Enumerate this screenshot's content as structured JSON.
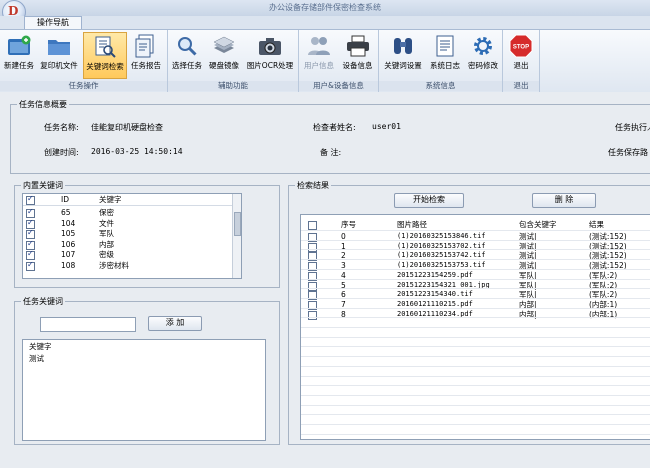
{
  "app": {
    "title": "办公设备存储部件保密检查系统",
    "logo_glyph": "D",
    "nav_tab": "操作导航"
  },
  "ribbon": {
    "groups": [
      {
        "label": "任务操作"
      },
      {
        "label": "辅助功能"
      },
      {
        "label": "用户&设备信息"
      },
      {
        "label": "系统信息"
      },
      {
        "label": "退出"
      }
    ],
    "buttons": {
      "new_task": "新建任务",
      "copier_files": "复印机文件",
      "keyword_search": "关键词检索",
      "task_report": "任务报告",
      "select_task": "选择任务",
      "disk_image": "硬盘镜像",
      "image_ocr": "图片OCR处理",
      "user_info": "用户信息",
      "device_info": "设备信息",
      "keyword_settings": "关键词设置",
      "system_log": "系统日志",
      "change_password": "密码修改",
      "exit": "退出",
      "stop_glyph": "STOP"
    }
  },
  "overview": {
    "legend": "任务信息概要",
    "task_name_label": "任务名称:",
    "task_name": "佳能复印机硬盘检查",
    "inspector_label": "检查者姓名:",
    "inspector": "user01",
    "executor_label": "任务执行人",
    "created_label": "创建时间:",
    "created": "2016-03-25 14:50:14",
    "note_label": "备      注:",
    "save_path_label": "任务保存路"
  },
  "builtin_keywords": {
    "legend": "内置关键词",
    "columns": [
      "ID",
      "关键字"
    ],
    "rows": [
      {
        "id": "65",
        "keyword": "保密"
      },
      {
        "id": "104",
        "keyword": "文件"
      },
      {
        "id": "105",
        "keyword": "军队"
      },
      {
        "id": "106",
        "keyword": "内部"
      },
      {
        "id": "107",
        "keyword": "密级"
      },
      {
        "id": "108",
        "keyword": "涉密材料"
      }
    ]
  },
  "task_keywords": {
    "legend": "任务关键词",
    "add_button": "添  加",
    "input_value": "",
    "column": "关键字",
    "rows": [
      "测试"
    ]
  },
  "results": {
    "legend": "检索结果",
    "start_button": "开始检索",
    "delete_button": "删  除",
    "columns": [
      "序号",
      "图片路径",
      "包含关键字",
      "结果"
    ],
    "rows": [
      {
        "no": "0",
        "path": "(1)20160325153846.tif",
        "kw": "测试|",
        "result": "(测试:152)"
      },
      {
        "no": "1",
        "path": "(1)20160325153702.tif",
        "kw": "测试|",
        "result": "(测试:152)"
      },
      {
        "no": "2",
        "path": "(1)20160325153742.tif",
        "kw": "测试|",
        "result": "(测试:152)"
      },
      {
        "no": "3",
        "path": "(1)20160325153753.tif",
        "kw": "测试|",
        "result": "(测试:152)"
      },
      {
        "no": "4",
        "path": "20151223154259.pdf",
        "kw": "军队|",
        "result": "(军队:2)"
      },
      {
        "no": "5",
        "path": "20151223154321_001.jpg",
        "kw": "军队|",
        "result": "(军队:2)"
      },
      {
        "no": "6",
        "path": "20151223154340.tif",
        "kw": "军队|",
        "result": "(军队:2)"
      },
      {
        "no": "7",
        "path": "20160121110215.pdf",
        "kw": "内部|",
        "result": "(内部:1)"
      },
      {
        "no": "8",
        "path": "20160121110234.pdf",
        "kw": "内部|",
        "result": "(内部:1)"
      }
    ]
  }
}
